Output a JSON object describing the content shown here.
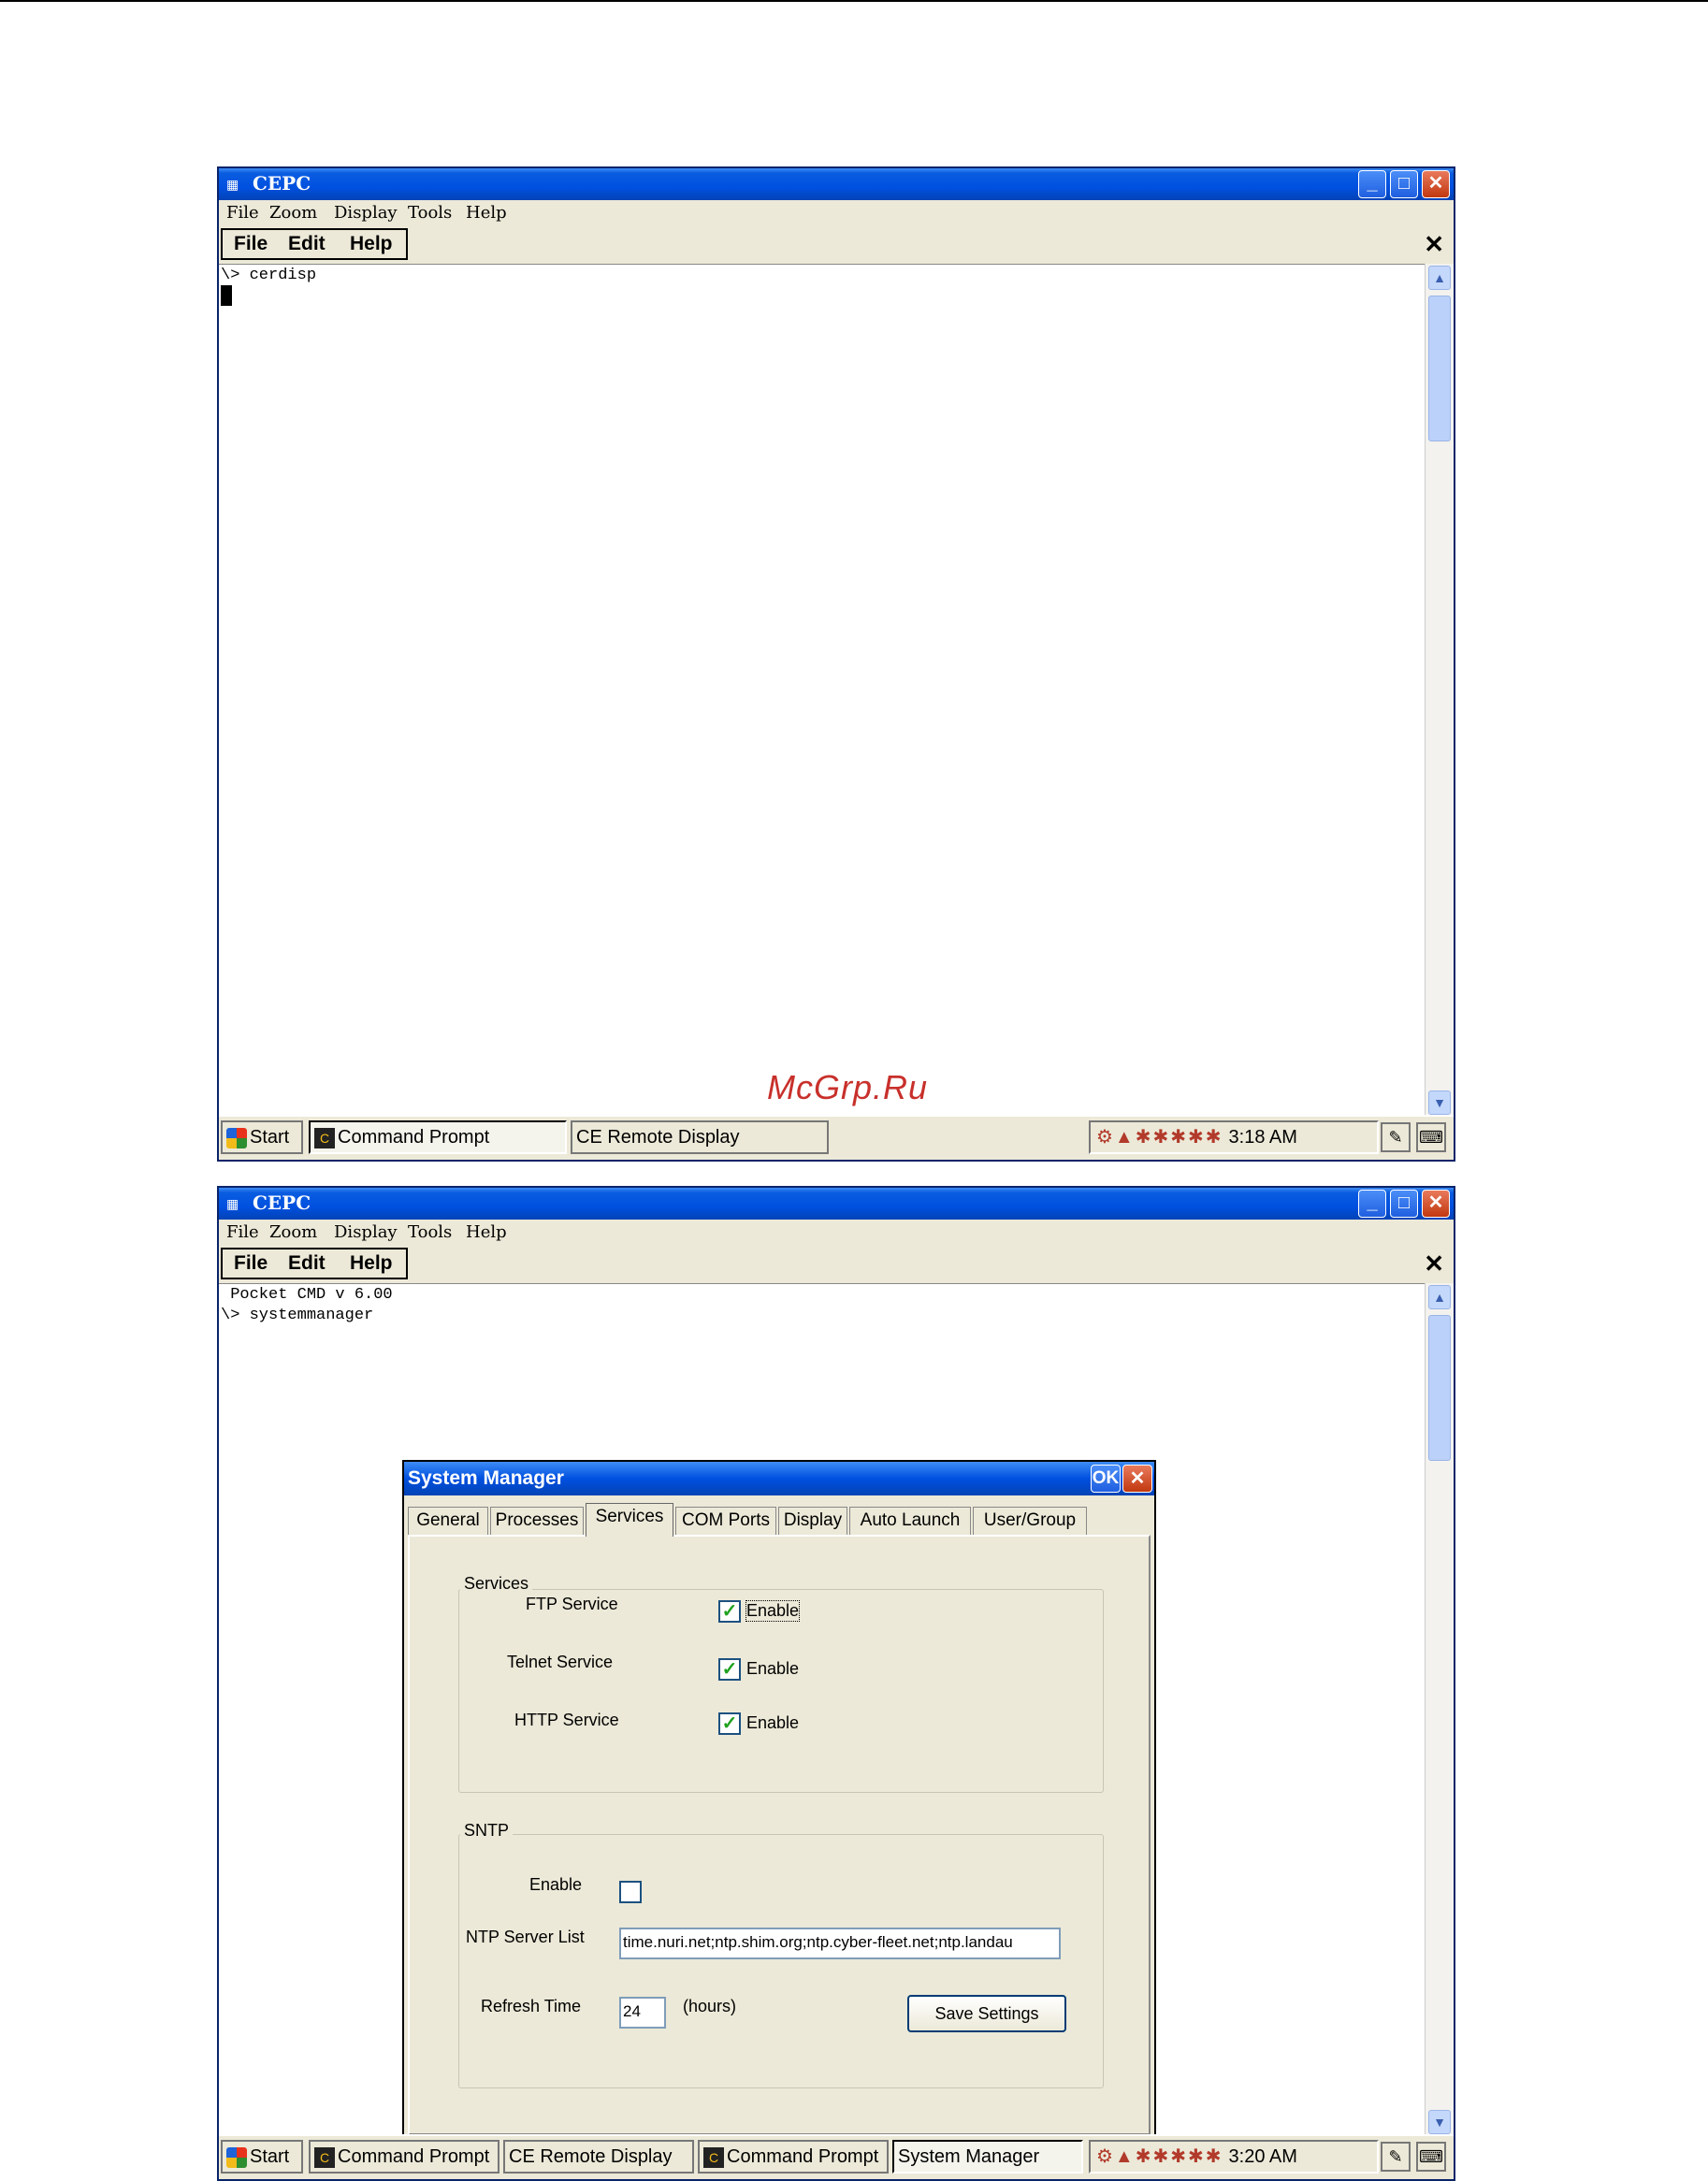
{
  "watermark": "McGrp.Ru",
  "windows": [
    {
      "title": "CEPC",
      "menu": [
        "File",
        "Zoom",
        "Display",
        "Tools",
        "Help"
      ],
      "cmdbar": [
        "File",
        "Edit",
        "Help"
      ],
      "console_lines": [
        "\\> cerdisp"
      ],
      "taskbar": {
        "start": "Start",
        "buttons": [
          "Command Prompt",
          "CE Remote Display"
        ],
        "clock": "3:18 AM"
      }
    },
    {
      "title": "CEPC",
      "menu": [
        "File",
        "Zoom",
        "Display",
        "Tools",
        "Help"
      ],
      "cmdbar": [
        "File",
        "Edit",
        "Help"
      ],
      "console_lines": [
        " Pocket CMD v 6.00",
        "\\> systemmanager"
      ],
      "taskbar": {
        "start": "Start",
        "buttons": [
          "Command Prompt",
          "CE Remote Display",
          "Command Prompt",
          "System Manager"
        ],
        "clock": "3:20 AM"
      }
    }
  ],
  "dialog": {
    "title": "System Manager",
    "ok": "OK",
    "tabs": [
      "General",
      "Processes",
      "Services",
      "COM Ports",
      "Display",
      "Auto Launch",
      "User/Group"
    ],
    "active_tab": "Services",
    "services_group": "Services",
    "services": [
      {
        "label": "FTP Service",
        "check_label": "Enable",
        "checked": true
      },
      {
        "label": "Telnet Service",
        "check_label": "Enable",
        "checked": true
      },
      {
        "label": "HTTP Service",
        "check_label": "Enable",
        "checked": true
      }
    ],
    "sntp_group": "SNTP",
    "sntp_enable_label": "Enable",
    "sntp_enabled": false,
    "ntp_label": "NTP Server List",
    "ntp_value": "time.nuri.net;ntp.shim.org;ntp.cyber-fleet.net;ntp.landau",
    "refresh_label": "Refresh Time",
    "refresh_value": "24",
    "refresh_unit": "(hours)",
    "save_button": "Save Settings"
  },
  "icons": {
    "start": "windows-flag-icon",
    "command_prompt": "command-prompt-icon",
    "tray": "tray-icons",
    "check": "checkmark-icon"
  }
}
